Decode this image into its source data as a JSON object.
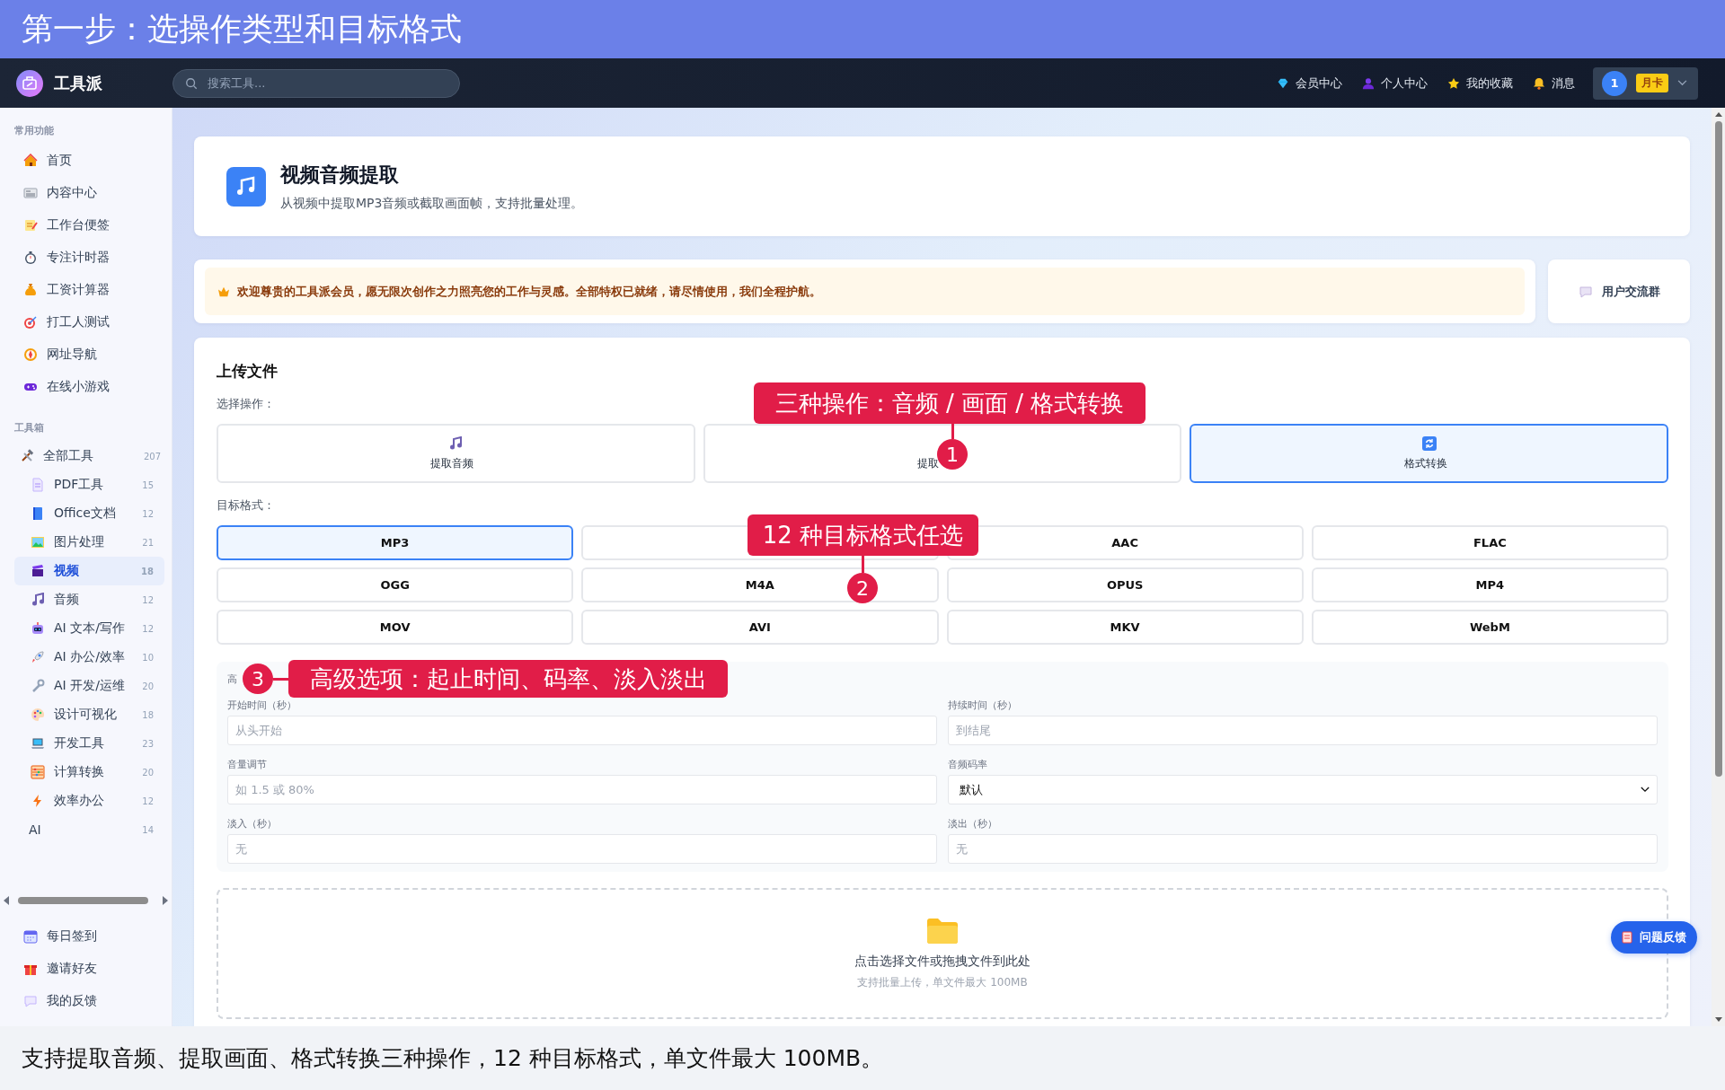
{
  "banner": {
    "title": "第一步：选操作类型和目标格式"
  },
  "header": {
    "brand": "工具派",
    "search": {
      "placeholder": "搜索工具..."
    },
    "nav": [
      {
        "label": "会员中心"
      },
      {
        "label": "个人中心"
      },
      {
        "label": "我的收藏"
      },
      {
        "label": "消息"
      }
    ],
    "user": {
      "avatar": "1",
      "badge": "月卡"
    }
  },
  "sidebar": {
    "sections": [
      {
        "title": "常用功能",
        "items": [
          {
            "label": "首页",
            "selected": false
          },
          {
            "label": "内容中心",
            "selected": false
          },
          {
            "label": "工作台便签",
            "selected": false
          },
          {
            "label": "专注计时器",
            "selected": false
          },
          {
            "label": "工资计算器",
            "selected": false
          },
          {
            "label": "打工人测试",
            "selected": false
          },
          {
            "label": "网址导航",
            "selected": false
          },
          {
            "label": "在线小游戏",
            "selected": false
          }
        ]
      },
      {
        "title": "工具箱",
        "items": [
          {
            "label": "全部工具",
            "count": "207",
            "selected": false,
            "children": [
              {
                "label": "PDF工具",
                "count": "15",
                "selected": false
              },
              {
                "label": "Office文档",
                "count": "12",
                "selected": false
              },
              {
                "label": "图片处理",
                "count": "21",
                "selected": false
              },
              {
                "label": "视频",
                "count": "18",
                "selected": true
              },
              {
                "label": "音频",
                "count": "12",
                "selected": false
              },
              {
                "label": "AI 文本/写作",
                "count": "12",
                "selected": false
              },
              {
                "label": "AI 办公/效率",
                "count": "10",
                "selected": false
              },
              {
                "label": "AI 开发/运维",
                "count": "20",
                "selected": false
              },
              {
                "label": "设计可视化",
                "count": "18",
                "selected": false
              },
              {
                "label": "开发工具",
                "count": "23",
                "selected": false
              },
              {
                "label": "计算转换",
                "count": "20",
                "selected": false
              },
              {
                "label": "效率办公",
                "count": "12",
                "selected": false
              },
              {
                "label": "AI",
                "count": "14",
                "selected": false
              }
            ]
          }
        ]
      }
    ],
    "footer_items": [
      {
        "label": "每日签到"
      },
      {
        "label": "邀请好友"
      },
      {
        "label": "我的反馈"
      }
    ]
  },
  "tool": {
    "title": "视频音频提取",
    "description": "从视频中提取MP3音频或截取画面帧，支持批量处理。"
  },
  "notice": {
    "text": "欢迎尊贵的工具派会员，愿无限次创作之力照亮您的工作与灵感。全部特权已就绪，请尽情使用，我们全程护航。"
  },
  "community": {
    "label": "用户交流群"
  },
  "upload": {
    "title": "上传文件",
    "operation_label": "选择操作：",
    "operations": [
      {
        "label": "提取音频",
        "selected": false
      },
      {
        "label": "提取",
        "selected": false
      },
      {
        "label": "格式转换",
        "selected": true
      }
    ],
    "format_label": "目标格式：",
    "formats": [
      {
        "label": "MP3",
        "selected": true
      },
      {
        "selected": false
      },
      {
        "label": "AAC",
        "selected": false
      },
      {
        "label": "FLAC",
        "selected": false
      },
      {
        "label": "OGG",
        "selected": false
      },
      {
        "label": "M4A",
        "selected": false
      },
      {
        "label": "OPUS",
        "selected": false
      },
      {
        "label": "MP4",
        "selected": false
      },
      {
        "label": "MOV",
        "selected": false
      },
      {
        "label": "AVI",
        "selected": false
      },
      {
        "label": "MKV",
        "selected": false
      },
      {
        "label": "WebM",
        "selected": false
      }
    ],
    "advanced": {
      "title": "高",
      "fields": [
        {
          "kind": "input",
          "label": "开始时间（秒）",
          "placeholder": "从头开始"
        },
        {
          "kind": "input",
          "label": "持续时间（秒）",
          "placeholder": "到结尾"
        },
        {
          "kind": "input",
          "label": "音量调节",
          "placeholder": "如 1.5 或 80%"
        },
        {
          "kind": "select",
          "label": "音频码率",
          "value": "默认"
        },
        {
          "kind": "input",
          "label": "淡入（秒）",
          "placeholder": "无"
        },
        {
          "kind": "input",
          "label": "淡出（秒）",
          "placeholder": "无"
        }
      ]
    },
    "dropzone": {
      "title": "点击选择文件或拖拽文件到此处",
      "hint": "支持批量上传，单文件最大 100MB"
    }
  },
  "feedback_button": {
    "label": "问题反馈"
  },
  "annotations": [
    {
      "number": "1",
      "text": "三种操作：音频 / 画面 / 格式转换"
    },
    {
      "number": "2",
      "text": "12 种目标格式任选"
    },
    {
      "number": "3",
      "text": "高级选项：起止时间、码率、淡入淡出"
    }
  ],
  "caption": {
    "text": "支持提取音频、提取画面、格式转换三种操作，12 种目标格式，单文件最大 100MB。"
  }
}
